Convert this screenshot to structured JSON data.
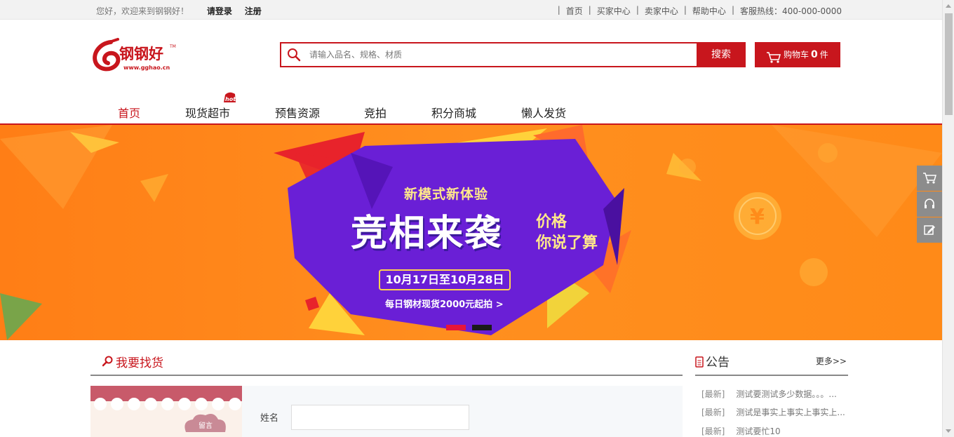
{
  "topbar": {
    "welcome": "您好，欢迎来到钢钢好！",
    "login": "请登录",
    "register": "注册",
    "links": [
      "首页",
      "买家中心",
      "卖家中心",
      "帮助中心"
    ],
    "hotline": "客服热线：400-000-0000"
  },
  "logo": {
    "name": "钢钢好",
    "url_text": "www.gghao.cn",
    "tm": "TM"
  },
  "search": {
    "placeholder": "请输入品名、规格、材质",
    "button": "搜索"
  },
  "cart": {
    "label": "购物车",
    "count": "0",
    "unit": "件"
  },
  "nav": {
    "items": [
      "首页",
      "现货超市",
      "预售资源",
      "竞拍",
      "积分商城",
      "懒人发货"
    ],
    "hot_badge": "hot"
  },
  "banner": {
    "subtitle": "新模式新体验",
    "title": "竞相来袭",
    "slogan_line1": "价格",
    "slogan_line2": "你说了算",
    "date": "10月17日至10月28日",
    "cta": "每日钢材现货2000元起拍 >",
    "coin_symbol": "¥"
  },
  "find": {
    "title": "我要找货",
    "name_label": "姓名",
    "badge": "留言"
  },
  "notice": {
    "title": "公告",
    "more": "更多>>",
    "items": [
      {
        "tag": "[最新]",
        "text": "测试要测试多少数据。。。..."
      },
      {
        "tag": "[最新]",
        "text": "测试是事实上事实上事实上..."
      },
      {
        "tag": "[最新]",
        "text": "测试要忙10"
      }
    ]
  },
  "colors": {
    "brand": "#c8161d",
    "banner_bg": "#ff8c1a",
    "banner_purple": "#6a1fd6"
  }
}
